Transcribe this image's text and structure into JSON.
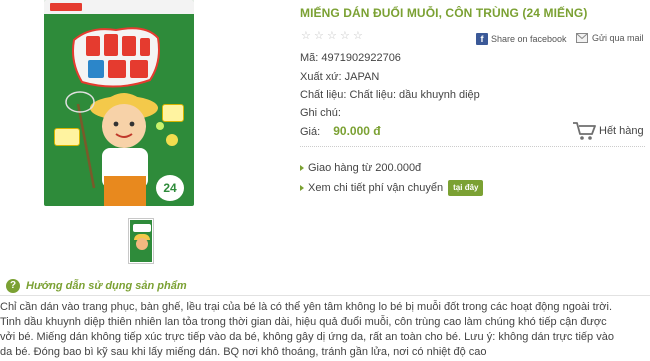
{
  "product": {
    "title": "MIẾNG DÁN ĐUỔI MUỖI, CÔN TRÙNG (24 MIẾNG)",
    "rating": {
      "value": 0,
      "max": 5
    },
    "share_facebook": "Share on facebook",
    "send_mail": "Gửi qua mail",
    "sku": "Mã: 4971902922706",
    "origin": "Xuất xứ: JAPAN",
    "material": "Chất liệu: Chất liệu: dầu khuynh diệp",
    "note": "Ghi chú:",
    "price_label": "Giá:",
    "price_value": "90.000 đ",
    "stock_status": "Hết hàng",
    "shipping_free": "Giao hàng từ 200.000đ",
    "shipping_fee": "Xem chi tiết phí vận chuyển",
    "shipping_fee_link": "tại đây",
    "image_count_text": "24"
  },
  "guide": {
    "title": "Hướng dẫn sử dụng sản phẩm",
    "lines": [
      "Chỉ cần dán vào trang phục, bàn ghế, lều trại của bé là có thể yên tâm không lo bé bị muỗi đốt trong các hoạt động ngoài trời.",
      "Tinh dầu khuynh diệp thiên nhiên lan tỏa trong thời gian dài, hiệu quả đuổi muỗi, côn trùng cao làm chúng khó tiếp cận được",
      "vởi bé. Miếng dán không tiếp xúc trực tiếp vào da bé, không gây dị ứng da, rất an toàn cho bé. Lưu ý: không dán trực tiếp vào",
      "da bé. Đóng bao bì kỹ sau khi lấy miếng dán. BQ nơi khô thoáng, tránh gần lửa, nơi có nhiệt độ cao"
    ]
  },
  "colors": {
    "accent": "#7ba133",
    "facebook": "#3b5998",
    "package_green": "#2e8b3a"
  }
}
